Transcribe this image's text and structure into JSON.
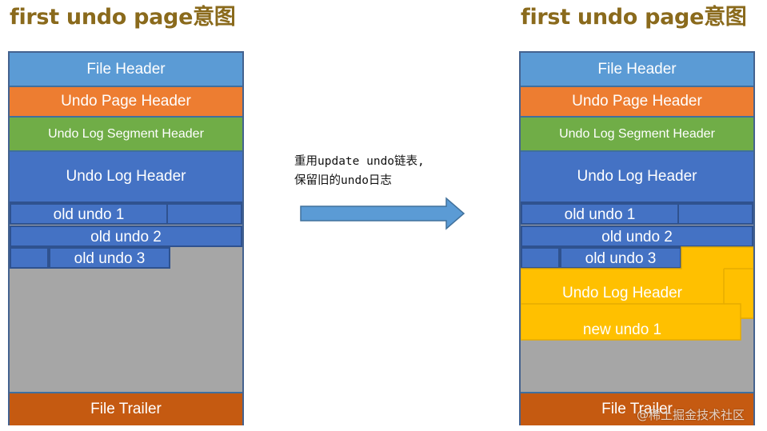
{
  "left": {
    "title": "first undo page意图",
    "file_header": "File Header",
    "undo_page_header": "Undo Page Header",
    "undo_log_segment_header": "Undo Log Segment Header",
    "undo_log_header": "Undo Log Header",
    "old_undo_1": "old undo 1",
    "old_undo_2": "old undo 2",
    "old_undo_3": "old undo 3",
    "file_trailer": "File Trailer"
  },
  "right": {
    "title": "first undo page意图",
    "file_header": "File Header",
    "undo_page_header": "Undo Page Header",
    "undo_log_segment_header": "Undo Log Segment Header",
    "undo_log_header": "Undo Log Header",
    "old_undo_1": "old undo 1",
    "old_undo_2": "old undo 2",
    "old_undo_3": "old undo 3",
    "new_undo_log_header": "Undo Log Header",
    "new_undo_1": "new undo 1",
    "file_trailer": "File Trailer"
  },
  "note": {
    "line1": "重用update undo链表,",
    "line2": "保留旧的undo日志"
  },
  "watermark": "@稀土掘金技术社区",
  "colors": {
    "title": "#8a6a1c",
    "file_header": "#5b9bd5",
    "undo_page_header": "#ed7d31",
    "undo_log_segment_header": "#70ad47",
    "undo_log": "#4472c4",
    "free_space": "#a6a6a6",
    "file_trailer": "#c55a11",
    "new_undo": "#ffc000",
    "arrow": "#5b9bd5"
  },
  "icons": {
    "arrow": "right-arrow-icon"
  }
}
